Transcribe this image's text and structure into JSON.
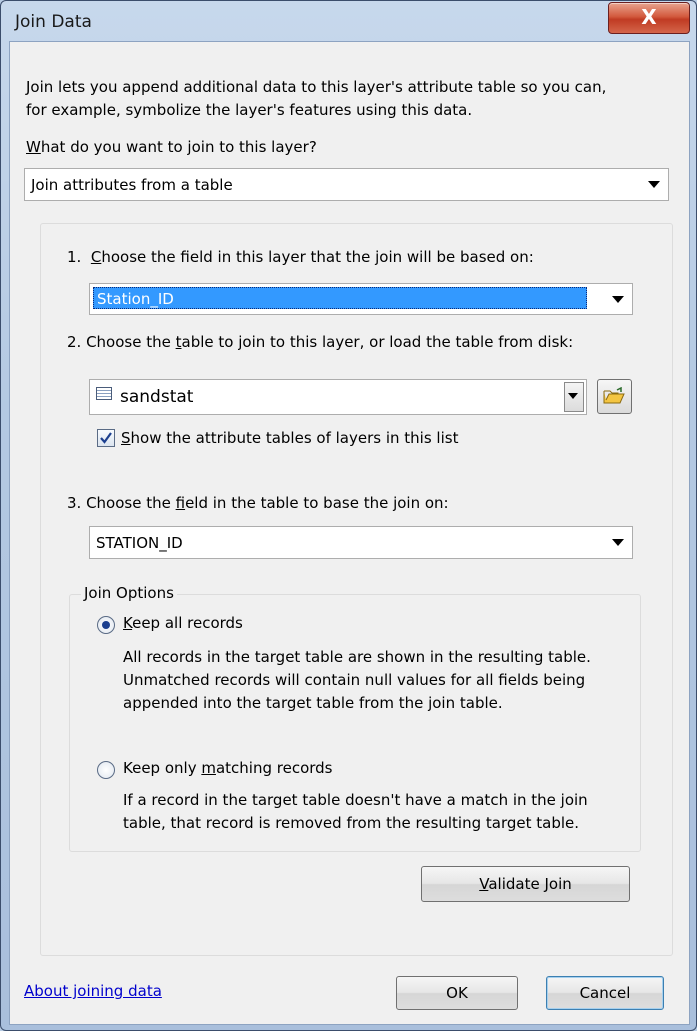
{
  "window": {
    "title": "Join Data",
    "close_glyph": "X"
  },
  "intro": {
    "line1": "Join lets you append additional data to this layer's attribute table so you can,",
    "line2": "for example, symbolize the layer's features using this data."
  },
  "question": {
    "first_letter": "W",
    "rest": "hat do you want to join to this layer?"
  },
  "join_type": {
    "selected": "Join attributes from a table"
  },
  "step1": {
    "prefix": "1.  ",
    "u": "C",
    "rest": "hoose the field in this layer that the join will be based on:",
    "selected": "Station_ID"
  },
  "step2": {
    "pre": "2.  Choose the ",
    "u": "t",
    "post": "able to join to this layer, or load the table from disk:",
    "selected": "sandstat",
    "table_icon": "table-icon",
    "open_icon": "open-folder-icon"
  },
  "show_tables": {
    "checked": true,
    "u": "S",
    "rest": "how the attribute tables of layers in this list"
  },
  "step3": {
    "pre": "3.  Choose the ",
    "u": "f",
    "post": "ield in the table to base the join on:",
    "selected": "STATION_ID"
  },
  "join_options": {
    "legend": "Join Options",
    "keep_all": {
      "selected": true,
      "u": "K",
      "rest": "eep all records",
      "desc1": "All records in the target table are shown in the resulting table.",
      "desc2": "Unmatched records will contain null values for all fields being",
      "desc3": "appended into the target table from the join table."
    },
    "keep_matching": {
      "selected": false,
      "pre": "Keep only ",
      "u": "m",
      "post": "atching records",
      "desc1": "If a record in the target table doesn't have a match in the join",
      "desc2": "table, that record is removed from the resulting target table."
    }
  },
  "validate": {
    "u": "V",
    "rest": "alidate Join"
  },
  "footer": {
    "link": "About joining data",
    "ok": "OK",
    "cancel": "Cancel"
  },
  "colors": {
    "selection": "#3399ff",
    "link": "#0000cc",
    "close": "#c03b23"
  }
}
